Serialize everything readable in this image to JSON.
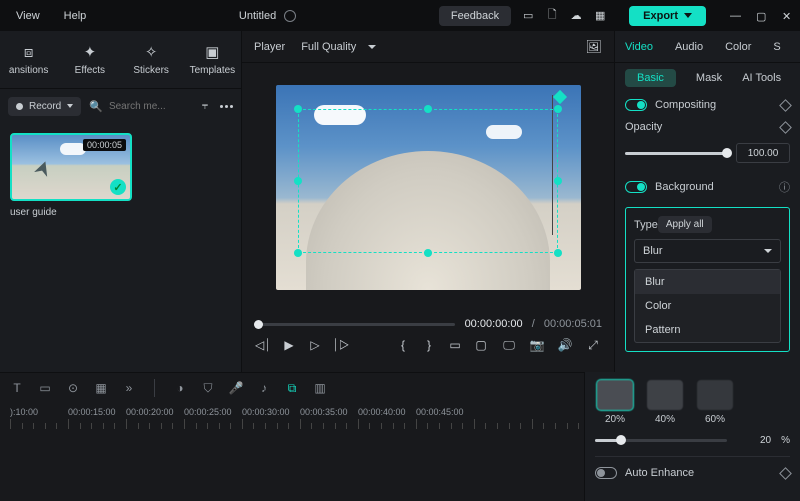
{
  "titlebar": {
    "view": "View",
    "help": "Help",
    "title": "Untitled",
    "feedback": "Feedback",
    "export": "Export"
  },
  "media_tabs": {
    "transitions": "ansitions",
    "effects": "Effects",
    "stickers": "Stickers",
    "templates": "Templates"
  },
  "media_toolbar": {
    "record": "Record",
    "search_placeholder": "Search me..."
  },
  "clip": {
    "duration": "00:00:05",
    "name": "user guide"
  },
  "player": {
    "player_label": "Player",
    "quality": "Full Quality",
    "current": "00:00:00:00",
    "sep": "/",
    "duration": "00:00:05:01"
  },
  "inspector": {
    "tabs": {
      "video": "Video",
      "audio": "Audio",
      "color": "Color",
      "s": "S"
    },
    "subtabs": {
      "basic": "Basic",
      "mask": "Mask",
      "ai": "AI Tools"
    },
    "compositing": "Compositing",
    "opacity": "Opacity",
    "opacity_value": "100.00",
    "background": "Background",
    "type": "Type",
    "apply_all": "Apply all",
    "dropdown_value": "Blur",
    "options": {
      "blur": "Blur",
      "color": "Color",
      "pattern": "Pattern"
    },
    "swatches": {
      "s20": "20%",
      "s40": "40%",
      "s60": "60%"
    },
    "blur_value": "20",
    "pct": "%",
    "auto_enhance": "Auto Enhance"
  },
  "ruler": {
    "t0": "):10:00",
    "t1": "00:00:15:00",
    "t2": "00:00:20:00",
    "t3": "00:00:25:00",
    "t4": "00:00:30:00",
    "t5": "00:00:35:00",
    "t6": "00:00:40:00",
    "t7": "00:00:45:00"
  }
}
